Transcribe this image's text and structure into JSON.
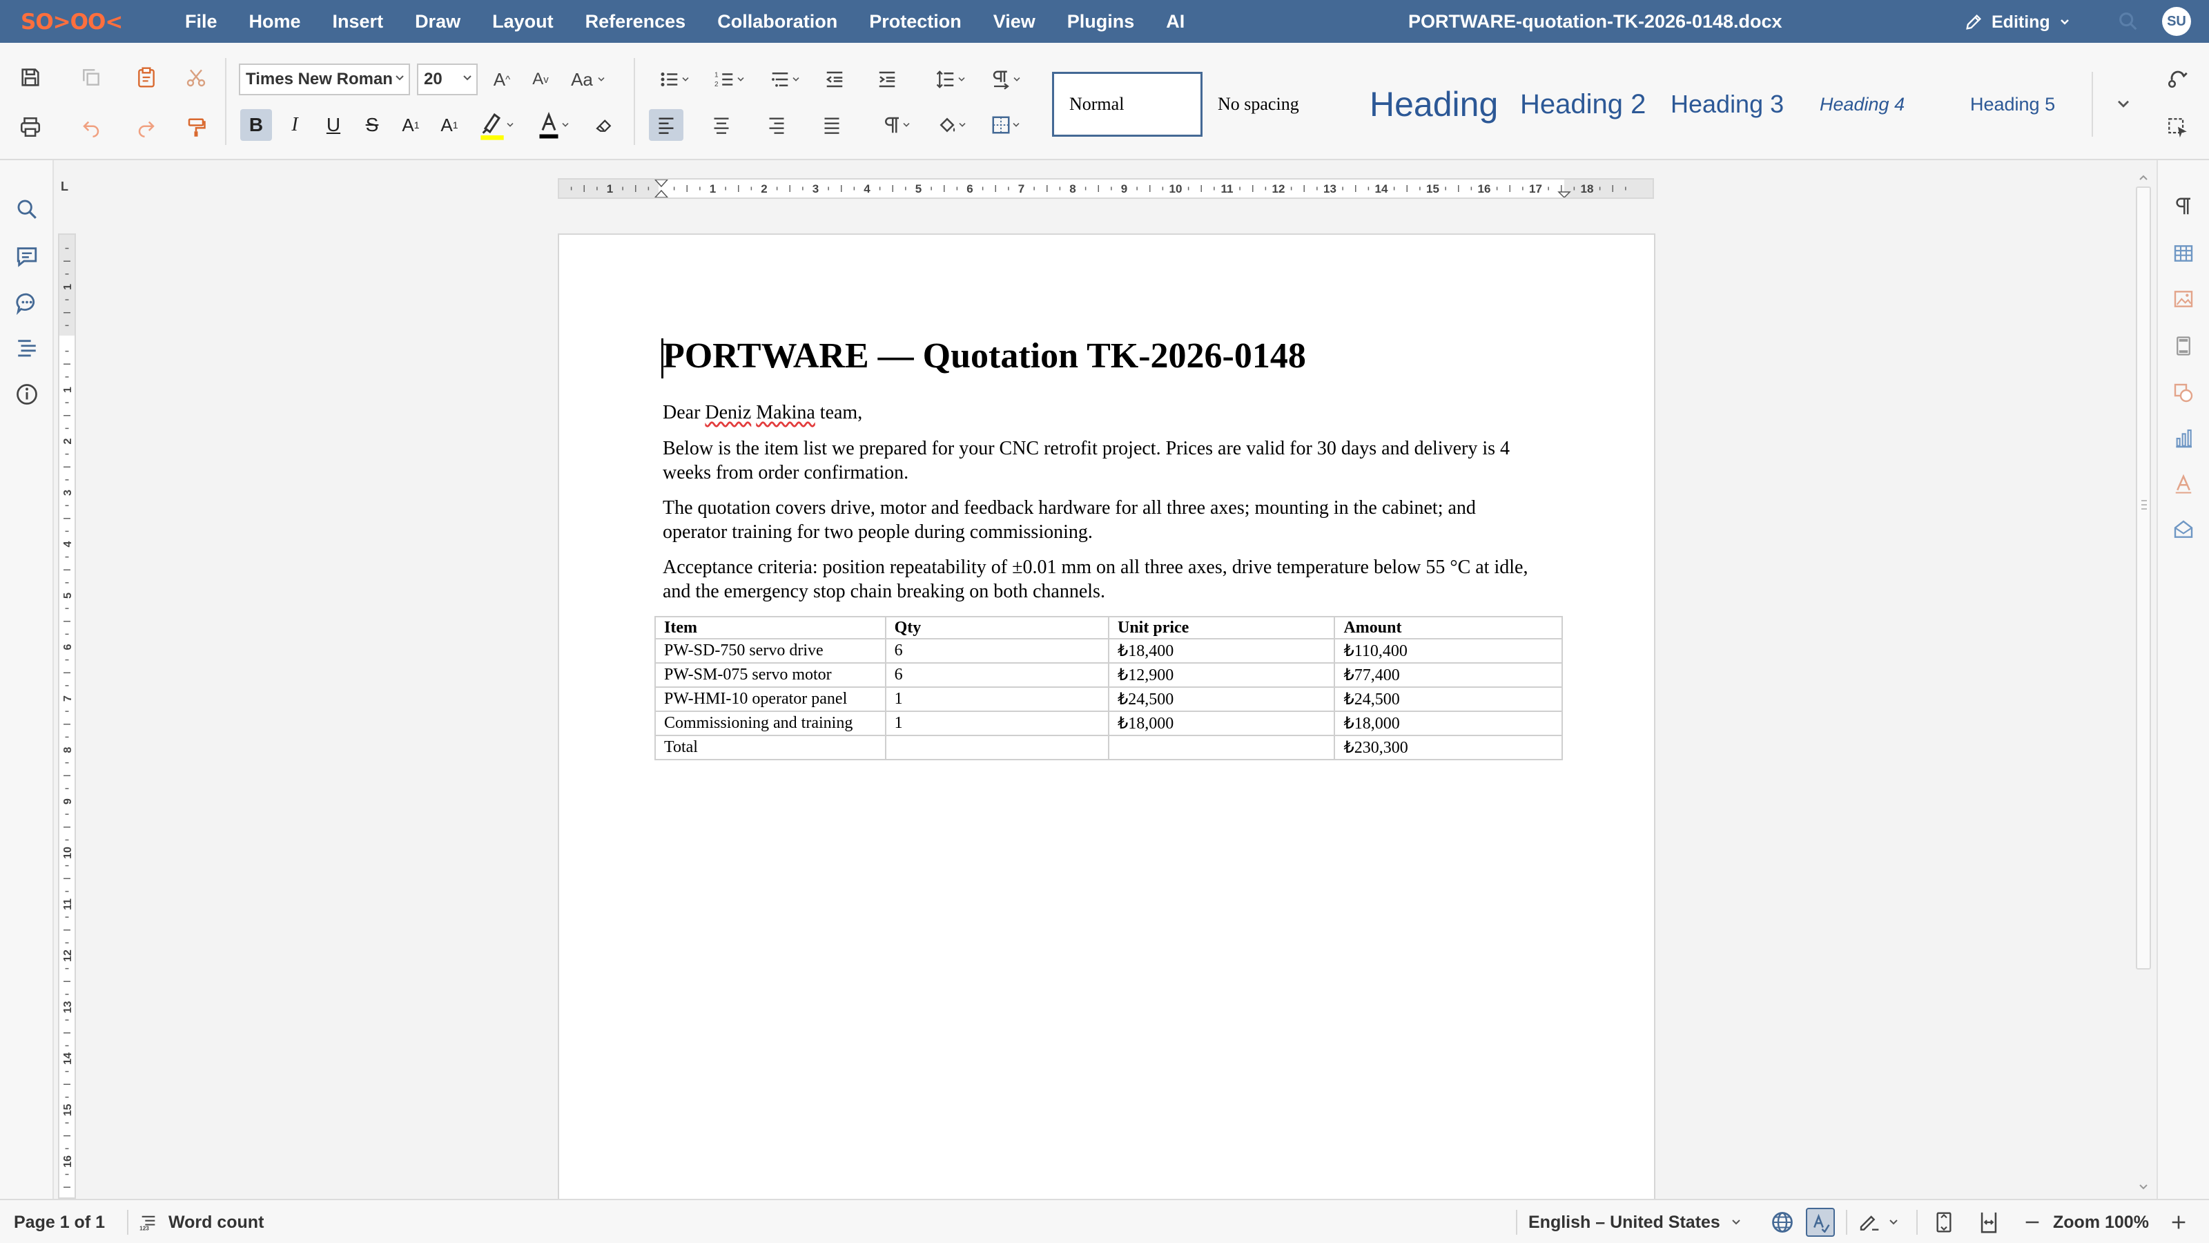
{
  "app": {
    "logo": "SO>OO<",
    "menu": [
      "File",
      "Home",
      "Insert",
      "Draw",
      "Layout",
      "References",
      "Collaboration",
      "Protection",
      "View",
      "Plugins",
      "AI"
    ],
    "doc_title": "PORTWARE-quotation-TK-2026-0148.docx",
    "mode": "Editing",
    "user_initials": "SU"
  },
  "toolbar": {
    "font_name": "Times New Roman",
    "font_size": "20",
    "styles": [
      "Normal",
      "No spacing",
      "Heading 1",
      "Heading 2",
      "Heading 3",
      "Heading 4",
      "Heading 5"
    ],
    "selected_style": "Normal",
    "active": [
      "bold",
      "align-left"
    ],
    "highlight_color": "#ffff00",
    "font_color": "#000000"
  },
  "ruler": {
    "corner": "L",
    "h_labels": [
      "1",
      "1",
      "2",
      "3",
      "4",
      "5",
      "6",
      "7",
      "8",
      "9",
      "10",
      "11",
      "12",
      "13",
      "14",
      "15",
      "16",
      "17",
      "18"
    ],
    "v_labels": [
      "1",
      "1",
      "2",
      "3",
      "4",
      "5",
      "6",
      "7",
      "8",
      "9",
      "10",
      "11",
      "12",
      "13",
      "14",
      "15",
      "16"
    ]
  },
  "document": {
    "heading": "PORTWARE — Quotation TK-2026-0148",
    "greeting_prefix": "Dear ",
    "greeting_name_1": "Deniz",
    "greeting_name_2": "Makina",
    "greeting_suffix": " team,",
    "paragraph_1": "Below is the item list we prepared for your CNC retrofit project. Prices are valid for 30 days and delivery is 4 weeks from order confirmation.",
    "paragraph_2": "The quotation covers drive, motor and feedback hardware for all three axes; mounting in the cabinet; and operator training for two people during commissioning.",
    "paragraph_3": "Acceptance criteria: position repeatability of ±0.01 mm on all three axes, drive temperature below 55 °C at idle, and the emergency stop chain breaking on both channels.",
    "table": {
      "headers": [
        "Item",
        "Qty",
        "Unit price",
        "Amount"
      ],
      "rows": [
        [
          "PW-SD-750 servo drive",
          "6",
          "₺18,400",
          "₺110,400"
        ],
        [
          "PW-SM-075 servo motor",
          "6",
          "₺12,900",
          "₺77,400"
        ],
        [
          "PW-HMI-10 operator panel",
          "1",
          "₺24,500",
          "₺24,500"
        ],
        [
          "Commissioning and training",
          "1",
          "₺18,000",
          "₺18,000"
        ]
      ],
      "total_label": "Total",
      "total_amount": "₺230,300"
    }
  },
  "status": {
    "page": "Page 1 of 1",
    "word_count": "Word count",
    "language": "English – United States",
    "zoom": "Zoom 100%"
  },
  "colors": {
    "brand": "#446995",
    "heading_style": "#2c5896"
  }
}
